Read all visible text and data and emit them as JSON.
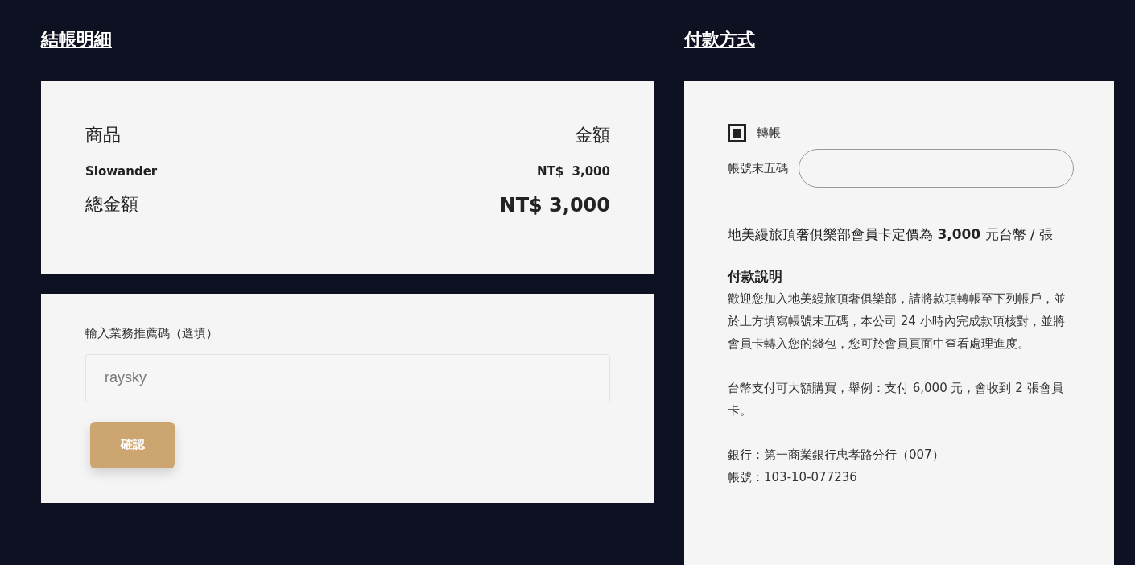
{
  "order_summary": {
    "title": "結帳明細",
    "header": {
      "item": "商品",
      "amount": "金額"
    },
    "items": [
      {
        "name": "Slowander",
        "price": "NT$  3,000"
      }
    ],
    "total": {
      "label": "總金額",
      "value": "NT$ 3,000"
    }
  },
  "referral": {
    "label": "輸入業務推薦碼（選填）",
    "value": "raysky",
    "button": "確認"
  },
  "payment": {
    "title": "付款方式",
    "methods": [
      {
        "label": "轉帳",
        "checked": true
      }
    ],
    "account_field": {
      "label": "帳號末五碼"
    },
    "price_note": "地美縵旅頂奢俱樂部會員卡定價為 **3,000** 元台幣 / 張",
    "instructions": {
      "title": "付款說明",
      "paragraphs": [
        "歡迎您加入地美縵旅頂奢俱樂部，請將款項轉帳至下列帳戶，並於上方填寫帳號末五碼，本公司 24 小時內完成款項核對，並將會員卡轉入您的錢包，您可於會員頁面中查看處理進度。",
        "台幣支付可大額購買，舉例：支付 6,000 元，會收到 2 張會員卡。"
      ],
      "bank_lines": [
        "銀行：第一商業銀行忠孝路分行（007）",
        "帳號：103-10-077236"
      ]
    }
  }
}
